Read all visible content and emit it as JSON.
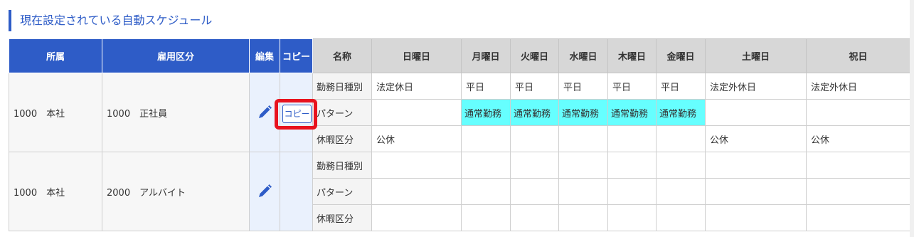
{
  "section_title": "現在設定されている自動スケジュール",
  "headers": {
    "affiliation": "所属",
    "employment": "雇用区分",
    "edit": "編集",
    "copy": "コピー",
    "name": "名称",
    "sun": "日曜日",
    "mon": "月曜日",
    "tue": "火曜日",
    "wed": "水曜日",
    "thu": "木曜日",
    "fri": "金曜日",
    "sat": "土曜日",
    "holiday": "祝日"
  },
  "copy_button_label": "コピー",
  "rows": [
    {
      "affiliation": "1000　本社",
      "employment": "1000　正社員",
      "lines": [
        {
          "label": "勤務日種別",
          "sun": "法定休日",
          "mon": "平日",
          "tue": "平日",
          "wed": "平日",
          "thu": "平日",
          "fri": "平日",
          "sat": "法定外休日",
          "holiday": "法定外休日"
        },
        {
          "label": "パターン",
          "sun": "",
          "mon": "通常勤務",
          "tue": "通常勤務",
          "wed": "通常勤務",
          "thu": "通常勤務",
          "fri": "通常勤務",
          "sat": "",
          "holiday": ""
        },
        {
          "label": "休暇区分",
          "sun": "公休",
          "mon": "",
          "tue": "",
          "wed": "",
          "thu": "",
          "fri": "",
          "sat": "公休",
          "holiday": "公休"
        }
      ]
    },
    {
      "affiliation": "1000　本社",
      "employment": "2000　アルバイト",
      "lines": [
        {
          "label": "勤務日種別",
          "sun": "",
          "mon": "",
          "tue": "",
          "wed": "",
          "thu": "",
          "fri": "",
          "sat": "",
          "holiday": ""
        },
        {
          "label": "パターン",
          "sun": "",
          "mon": "",
          "tue": "",
          "wed": "",
          "thu": "",
          "fri": "",
          "sat": "",
          "holiday": ""
        },
        {
          "label": "休暇区分",
          "sun": "",
          "mon": "",
          "tue": "",
          "wed": "",
          "thu": "",
          "fri": "",
          "sat": "",
          "holiday": ""
        }
      ]
    }
  ],
  "colors": {
    "accent": "#2e5cc7",
    "highlight": "#e8121e",
    "pattern_cell": "#66ffff"
  },
  "icons": {
    "edit": "pencil-icon"
  }
}
